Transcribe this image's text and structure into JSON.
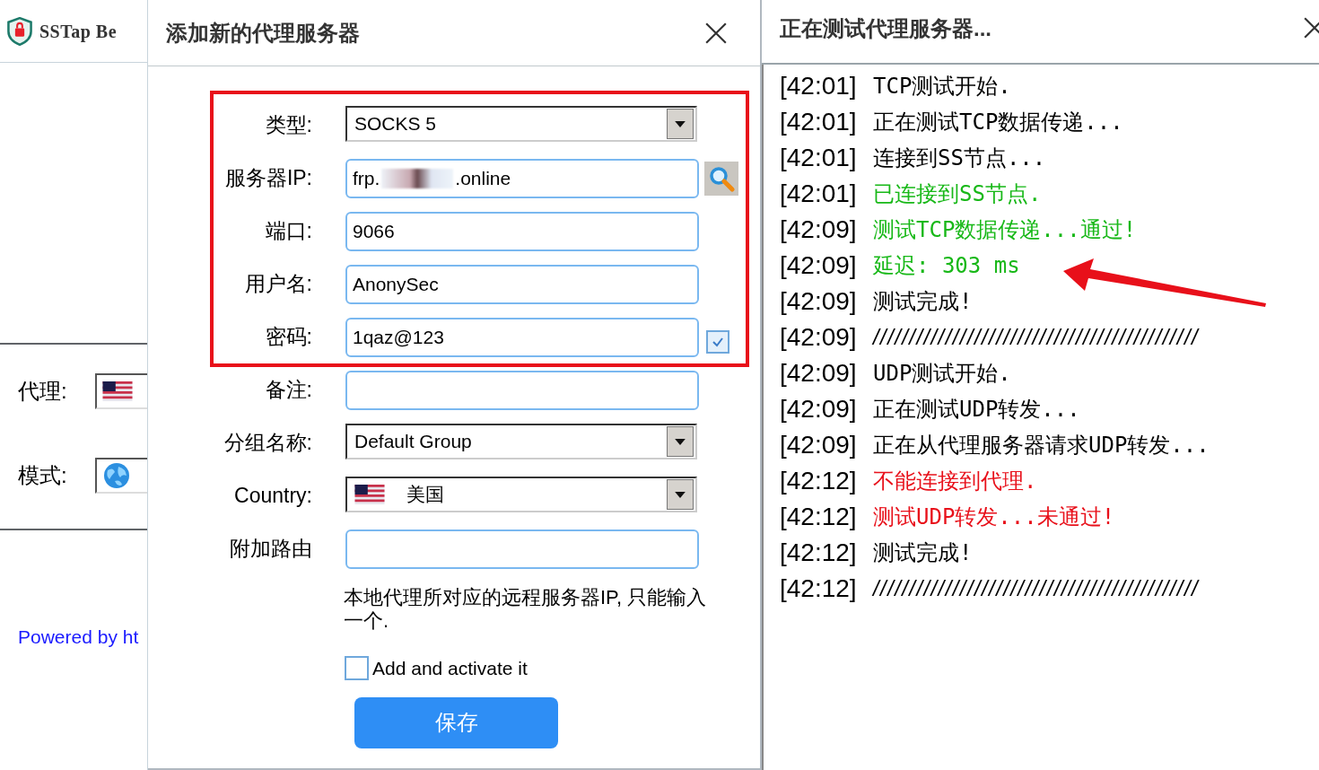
{
  "main_window": {
    "title": "SSTap Be",
    "proxy_label": "代理:",
    "mode_label": "模式:",
    "footer_link": "Powered by ht"
  },
  "dialog": {
    "title": "添加新的代理服务器",
    "highlight_box": true,
    "fields": [
      {
        "kind": "select",
        "label": "类型:",
        "value": "SOCKS 5"
      },
      {
        "kind": "ip",
        "label": "服务器IP:",
        "value_start": "frp.",
        "value_end": ".online"
      },
      {
        "kind": "text",
        "label": "端口:",
        "value": "9066"
      },
      {
        "kind": "text",
        "label": "用户名:",
        "value": "AnonySec"
      },
      {
        "kind": "password",
        "label": "密码:",
        "value": "1qaz@123",
        "checked": true
      },
      {
        "kind": "text",
        "label": "备注:"
      },
      {
        "kind": "select",
        "label": "分组名称:",
        "value": "Default Group"
      },
      {
        "kind": "country",
        "label": "Country:",
        "value": "美国"
      },
      {
        "kind": "text",
        "label": "附加路由"
      }
    ],
    "hint": "本地代理所对应的远程服务器IP, 只能输入一个.",
    "activate": {
      "label": "Add and activate it",
      "checked": false
    },
    "save_button": "保存"
  },
  "log": {
    "title": "正在测试代理服务器...",
    "arrow": true,
    "entries": [
      {
        "kind": "line",
        "time": "[42:01]",
        "message": "TCP测试开始.",
        "color": "#000000"
      },
      {
        "kind": "line",
        "time": "[42:01]",
        "message": "正在测试TCP数据传递...",
        "color": "#000000"
      },
      {
        "kind": "line",
        "time": "[42:01]",
        "message": "连接到SS节点...",
        "color": "#000000"
      },
      {
        "kind": "line",
        "time": "[42:01]",
        "message": "已连接到SS节点.",
        "color": "#18b818"
      },
      {
        "kind": "line",
        "time": "[42:09]",
        "message": "测试TCP数据传递...通过!",
        "color": "#18b818"
      },
      {
        "kind": "line",
        "time": "[42:09]",
        "message": "延迟: 303 ms",
        "color": "#18b818"
      },
      {
        "kind": "line",
        "time": "[42:09]",
        "message": "测试完成!",
        "color": "#000000"
      },
      {
        "kind": "separator",
        "time": "[42:09]",
        "message": "/////////////////////////////////////////////",
        "color": "#000000"
      },
      {
        "kind": "line",
        "time": "[42:09]",
        "message": "UDP测试开始.",
        "color": "#000000"
      },
      {
        "kind": "line",
        "time": "[42:09]",
        "message": "正在测试UDP转发...",
        "color": "#000000"
      },
      {
        "kind": "line",
        "time": "[42:09]",
        "message": "正在从代理服务器请求UDP转发...",
        "color": "#000000"
      },
      {
        "kind": "line",
        "time": "[42:12]",
        "message": "不能连接到代理.",
        "color": "#e8101a"
      },
      {
        "kind": "line",
        "time": "[42:12]",
        "message": "测试UDP转发...未通过!",
        "color": "#e8101a"
      },
      {
        "kind": "line",
        "time": "[42:12]",
        "message": "测试完成!",
        "color": "#000000"
      },
      {
        "kind": "separator",
        "time": "[42:12]",
        "message": "/////////////////////////////////////////////",
        "color": "#000000"
      }
    ]
  }
}
